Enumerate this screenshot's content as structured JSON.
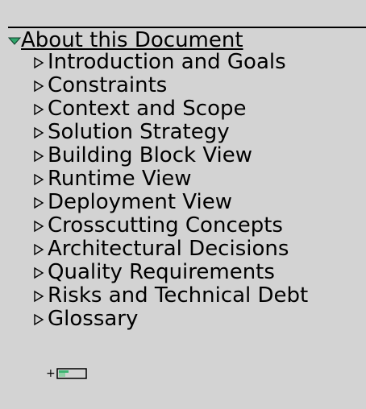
{
  "outline": {
    "root": {
      "label": "About this Document",
      "expanded": true,
      "toggle_icon": "triangle-down-expanded-icon",
      "toggle_color": "#2fa56b"
    },
    "children": [
      {
        "label": "Introduction and Goals",
        "toggle_icon": "triangle-right-collapsed-icon"
      },
      {
        "label": "Constraints",
        "toggle_icon": "triangle-right-collapsed-icon"
      },
      {
        "label": "Context and Scope",
        "toggle_icon": "triangle-right-collapsed-icon"
      },
      {
        "label": "Solution Strategy",
        "toggle_icon": "triangle-right-collapsed-icon"
      },
      {
        "label": "Building Block View",
        "toggle_icon": "triangle-right-collapsed-icon"
      },
      {
        "label": "Runtime View",
        "toggle_icon": "triangle-right-collapsed-icon"
      },
      {
        "label": "Deployment View",
        "toggle_icon": "triangle-right-collapsed-icon"
      },
      {
        "label": "Crosscutting Concepts",
        "toggle_icon": "triangle-right-collapsed-icon"
      },
      {
        "label": "Architectural Decisions",
        "toggle_icon": "triangle-right-collapsed-icon"
      },
      {
        "label": "Quality Requirements",
        "toggle_icon": "triangle-right-collapsed-icon"
      },
      {
        "label": "Risks and Technical Debt",
        "toggle_icon": "triangle-right-collapsed-icon"
      },
      {
        "label": "Glossary",
        "toggle_icon": "triangle-right-collapsed-icon"
      }
    ],
    "add_node": {
      "label": "+",
      "icon": "new-node-icon",
      "icon_color": "#3cb371"
    }
  }
}
